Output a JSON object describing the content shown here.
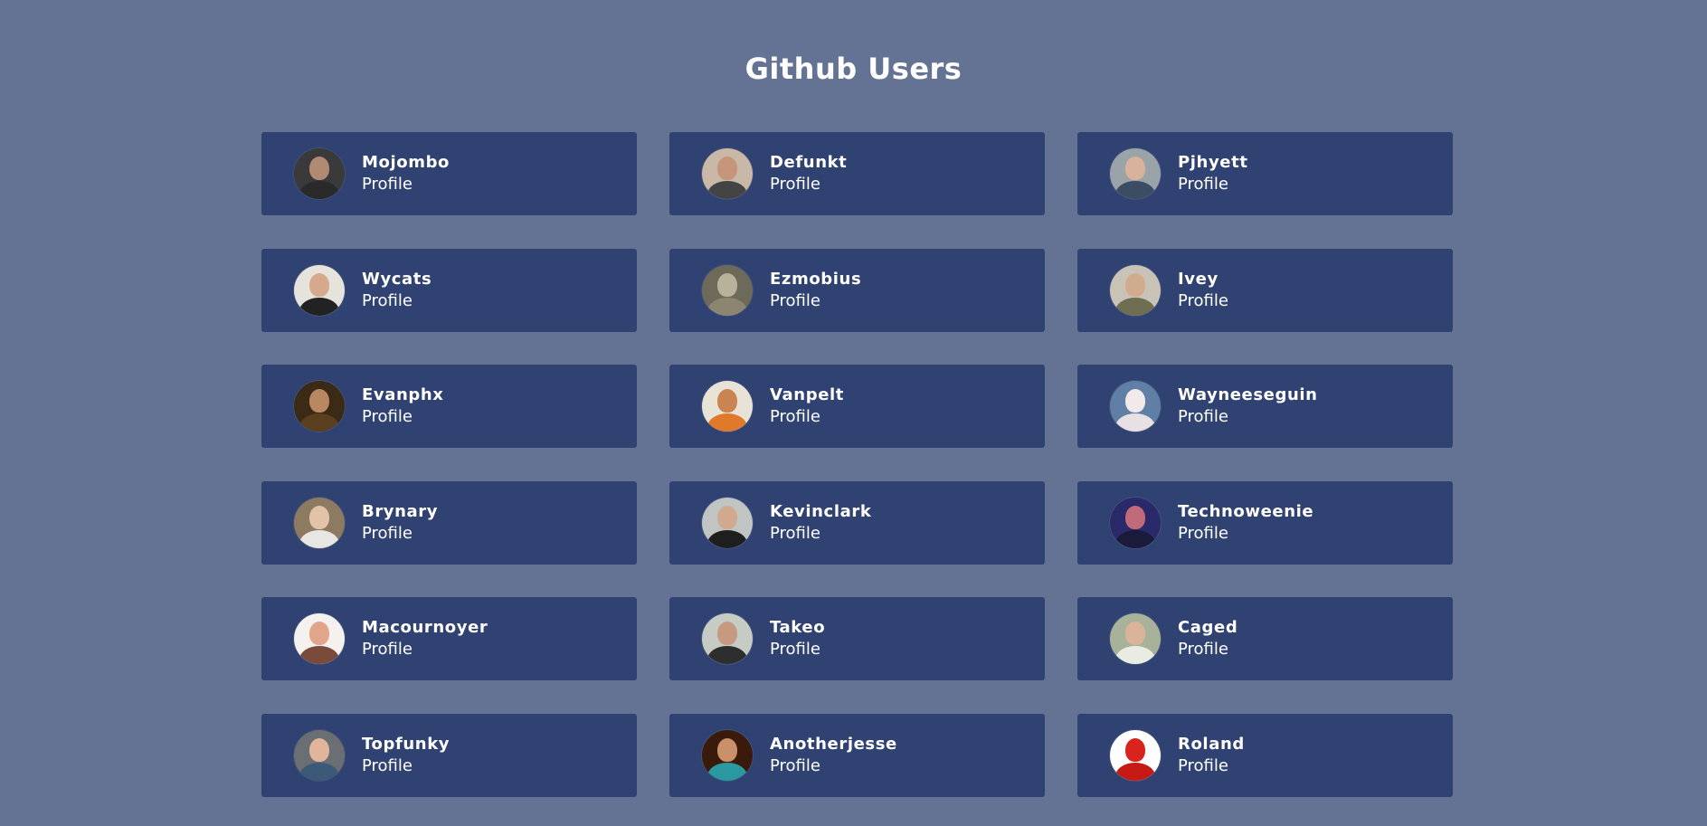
{
  "title": "Github Users",
  "users": [
    {
      "name": "Mojombo",
      "link": "Profile",
      "avatar": {
        "bg": "#3a3a3a",
        "skin": "#b08a72",
        "shirt": "#2a2a2a"
      }
    },
    {
      "name": "Defunkt",
      "link": "Profile",
      "avatar": {
        "bg": "#c9b7a8",
        "skin": "#c4957a",
        "shirt": "#444444"
      }
    },
    {
      "name": "Pjhyett",
      "link": "Profile",
      "avatar": {
        "bg": "#9aa3a8",
        "skin": "#d8b29a",
        "shirt": "#3b4d62"
      }
    },
    {
      "name": "Wycats",
      "link": "Profile",
      "avatar": {
        "bg": "#e6e3dd",
        "skin": "#d7a98c",
        "shirt": "#222222"
      }
    },
    {
      "name": "Ezmobius",
      "link": "Profile",
      "avatar": {
        "bg": "#6d6a5a",
        "skin": "#b9b29a",
        "shirt": "#8c8670"
      }
    },
    {
      "name": "Ivey",
      "link": "Profile",
      "avatar": {
        "bg": "#c9c2b6",
        "skin": "#d1ab8e",
        "shirt": "#6f6e52"
      }
    },
    {
      "name": "Evanphx",
      "link": "Profile",
      "avatar": {
        "bg": "#3a2a16",
        "skin": "#b98862",
        "shirt": "#5a4020"
      }
    },
    {
      "name": "Vanpelt",
      "link": "Profile",
      "avatar": {
        "bg": "#e9e2d6",
        "skin": "#c98452",
        "shirt": "#e07a2a"
      }
    },
    {
      "name": "Wayneeseguin",
      "link": "Profile",
      "avatar": {
        "bg": "#5f7fa4",
        "skin": "#f1e9ea",
        "shirt": "#e8e0e2"
      }
    },
    {
      "name": "Brynary",
      "link": "Profile",
      "avatar": {
        "bg": "#8c7a61",
        "skin": "#e2c3a7",
        "shirt": "#e8e6e2"
      }
    },
    {
      "name": "Kevinclark",
      "link": "Profile",
      "avatar": {
        "bg": "#c0c4c2",
        "skin": "#d1a98e",
        "shirt": "#1e1e1e"
      }
    },
    {
      "name": "Technoweenie",
      "link": "Profile",
      "avatar": {
        "bg": "#2a2a6a",
        "skin": "#c06a7a",
        "shirt": "#1a1a3a"
      }
    },
    {
      "name": "Macournoyer",
      "link": "Profile",
      "avatar": {
        "bg": "#f4f1ee",
        "skin": "#e0a58a",
        "shirt": "#7a4a3a"
      }
    },
    {
      "name": "Takeo",
      "link": "Profile",
      "avatar": {
        "bg": "#c6cbc4",
        "skin": "#c69a80",
        "shirt": "#2e2e2e"
      }
    },
    {
      "name": "Caged",
      "link": "Profile",
      "avatar": {
        "bg": "#a8b29a",
        "skin": "#d9b49a",
        "shirt": "#e8ece2"
      }
    },
    {
      "name": "Topfunky",
      "link": "Profile",
      "avatar": {
        "bg": "#6b6e72",
        "skin": "#e0b59a",
        "shirt": "#3c5a78"
      }
    },
    {
      "name": "Anotherjesse",
      "link": "Profile",
      "avatar": {
        "bg": "#3a1a0a",
        "skin": "#c9906a",
        "shirt": "#2a9aa0"
      }
    },
    {
      "name": "Roland",
      "link": "Profile",
      "avatar": {
        "bg": "#ffffff",
        "skin": "#d8241c",
        "shirt": "#c81a14"
      }
    }
  ]
}
